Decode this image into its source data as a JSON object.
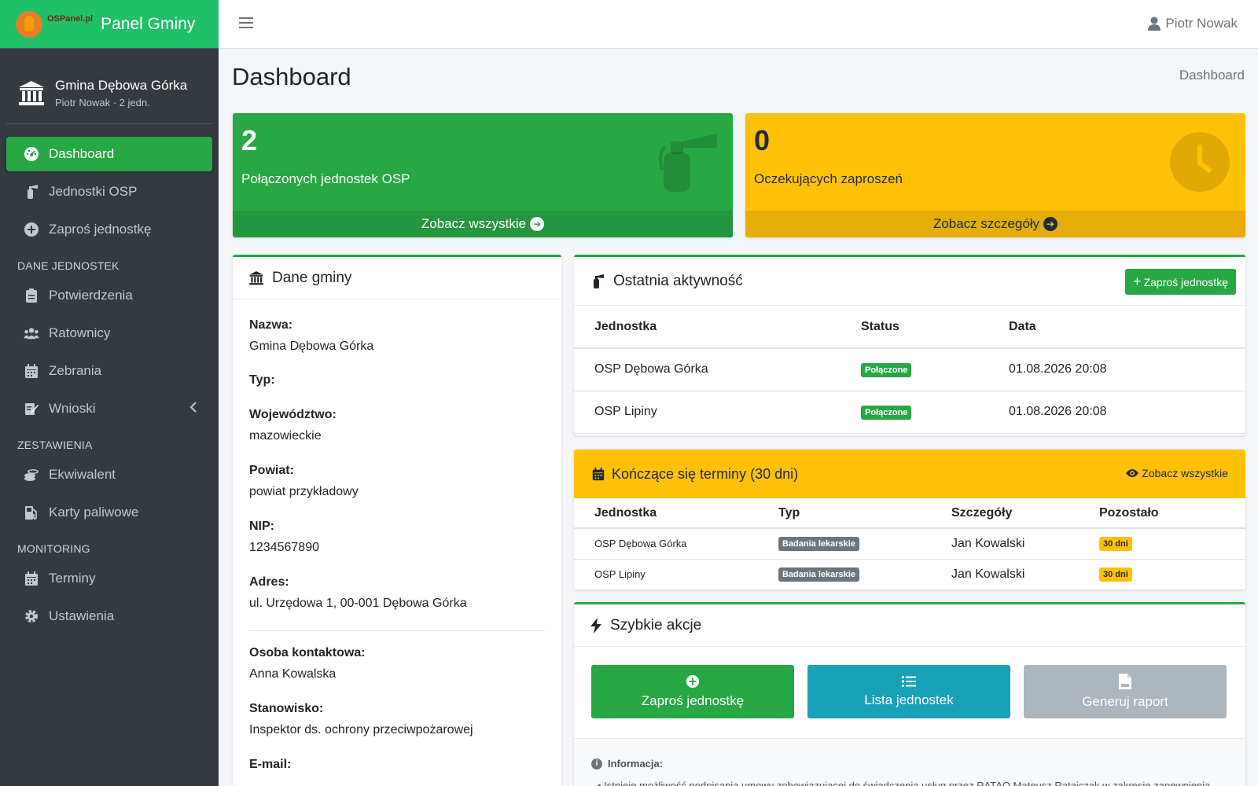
{
  "brand": {
    "small": "OSPanel.pl",
    "title": "Panel Gminy"
  },
  "user_panel": {
    "name": "Gmina Dębowa Górka",
    "sub": "Piotr Nowak · 2 jedn."
  },
  "nav": {
    "items": [
      {
        "label": "Dashboard",
        "icon": "dashboard-icon"
      },
      {
        "label": "Jednostki OSP",
        "icon": "fire-extinguisher-icon"
      },
      {
        "label": "Zaproś jednostkę",
        "icon": "plus-circle-icon"
      }
    ],
    "header_data": "DANE JEDNOSTEK",
    "data_items": [
      {
        "label": "Potwierdzenia",
        "icon": "clipboard-icon"
      },
      {
        "label": "Ratownicy",
        "icon": "users-icon"
      },
      {
        "label": "Zebrania",
        "icon": "calendar-icon"
      },
      {
        "label": "Wnioski",
        "icon": "edit-icon"
      }
    ],
    "header_reports": "ZESTAWIENIA",
    "report_items": [
      {
        "label": "Ekwiwalent",
        "icon": "coins-icon"
      },
      {
        "label": "Karty paliwowe",
        "icon": "gas-pump-icon"
      }
    ],
    "header_monitoring": "MONITORING",
    "monitoring_items": [
      {
        "label": "Terminy",
        "icon": "calendar-icon"
      },
      {
        "label": "Ustawienia",
        "icon": "gear-icon"
      }
    ]
  },
  "topbar": {
    "user": "Piotr Nowak"
  },
  "page": {
    "title": "Dashboard",
    "breadcrumb": "Dashboard"
  },
  "stats": {
    "connected": {
      "value": "2",
      "label": "Połączonych jednostek OSP",
      "link": "Zobacz wszystkie"
    },
    "pending": {
      "value": "0",
      "label": "Oczekujących zaproszeń",
      "link": "Zobacz szczegóły"
    }
  },
  "gmina": {
    "title": "Dane gminy",
    "fields": [
      {
        "label": "Nazwa:",
        "value": "Gmina Dębowa Górka"
      },
      {
        "label": "Typ:",
        "value": ""
      },
      {
        "label": "Województwo:",
        "value": "mazowieckie"
      },
      {
        "label": "Powiat:",
        "value": "powiat przykładowy"
      },
      {
        "label": "NIP:",
        "value": "1234567890"
      },
      {
        "label": "Adres:",
        "value": "ul. Urzędowa 1, 00-001 Dębowa Górka"
      }
    ],
    "contact": [
      {
        "label": "Osoba kontaktowa:",
        "value": "Anna Kowalska"
      },
      {
        "label": "Stanowisko:",
        "value": "Inspektor ds. ochrony przeciwpożarowej"
      },
      {
        "label": "E-mail:",
        "value": ""
      }
    ]
  },
  "activity": {
    "title": "Ostatnia aktywność",
    "button": "Zaproś jednostkę",
    "columns": [
      "Jednostka",
      "Status",
      "Data"
    ],
    "rows": [
      {
        "unit": "OSP Dębowa Górka",
        "status": "Połączone",
        "date": "01.08.2026 20:08"
      },
      {
        "unit": "OSP Lipiny",
        "status": "Połączone",
        "date": "01.08.2026 20:08"
      }
    ]
  },
  "terms": {
    "title": "Kończące się terminy (30 dni)",
    "link": "Zobacz wszystkie",
    "columns": [
      "Jednostka",
      "Typ",
      "Szczegóły",
      "Pozostało"
    ],
    "rows": [
      {
        "unit": "OSP Dębowa Górka",
        "type": "Badania lekarskie",
        "details": "Jan Kowalski",
        "left": "30 dni"
      },
      {
        "unit": "OSP Lipiny",
        "type": "Badania lekarskie",
        "details": "Jan Kowalski",
        "left": "30 dni"
      }
    ]
  },
  "quick": {
    "title": "Szybkie akcje",
    "invite": "Zaproś jednostkę",
    "list": "Lista jednostek",
    "report": "Generuj raport"
  },
  "info": {
    "title": "Informacja:",
    "text": "Istnieje możliwość podpisania umowy zobowiązującej do świadczenia usług przez RATAO Mateusz Ratajczak w zakresie zapewnienia"
  },
  "colors": {
    "primary": "#28a745",
    "warning": "#ffc107",
    "info": "#17a2b8",
    "sidebar": "#343a40",
    "brand": "#20c06a"
  }
}
